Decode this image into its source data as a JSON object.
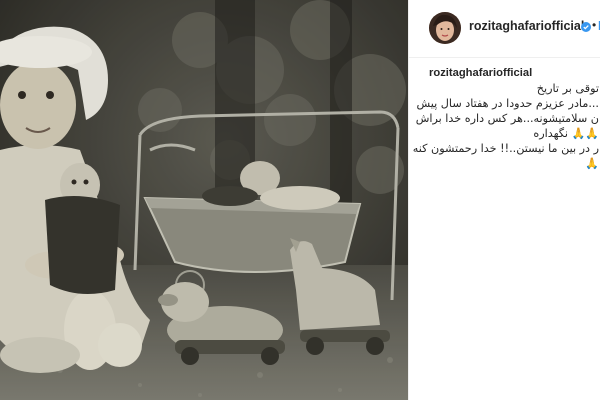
{
  "post": {
    "author": {
      "username": "rozitaghafariofficial",
      "verified_icon": "verified-badge-icon",
      "follow_label": "F"
    },
    "separator": "•",
    "caption": {
      "lines": [
        "توقی بر تاریخ",
        "...مادر عزیزم حدودا در هفتاد سال پیش",
        "ن سلامتیشونه...هر کس داره خدا براش",
        "نگهداره",
        "ر در بین ما نیستن..!! خدا رحمتشون کنه"
      ]
    },
    "colors": {
      "link": "#3897f0",
      "text": "#262626",
      "divider": "#efefef"
    }
  }
}
